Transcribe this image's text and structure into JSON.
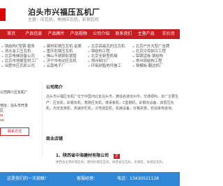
{
  "header": {
    "brand": "泊头市兴福压瓦机厂",
    "brand_sub": "主营：压瓦机，角驰压瓦机，彩钢瓦机"
  },
  "nav": [
    "首页",
    "产品信息",
    "产品图片",
    "产品视频",
    "公司介绍",
    "联系我们",
    "主营产品",
    "实价页"
  ],
  "links": [
    [
      "钢结构C型钢·檩条",
      "清水金工压瓦机",
      "北京电梯设备公司",
      "北京市地暖管材工厂",
      "合肥市压瓦机公司"
    ],
    [
      "建材彩钢压瓦机·金属",
      "重庆彩钢压瓦机",
      "佛山不锈钢彩钢管",
      "济宁市电动压瓦机",
      "云南电子厂"
    ],
    [
      "北京高级瓦的压瓦机",
      "钢结构工程",
      "北京全新型机械",
      "郑州制冷厂",
      "环氧树脂地坪施工"
    ],
    [
      "北京户外大型广告牌",
      "北京冷库制冷工程",
      "铝镁锰板·钢结构",
      "常州钢结构工程",
      "钢模板·翻边机厂"
    ]
  ],
  "left": {
    "line1": "公司简介压瓦机厂",
    "line2": "地址：泊头市开发区",
    "red1": "ie",
    "red2": "se",
    "button": "联系方式"
  },
  "about": {
    "title": "公司简介",
    "body": "泊头市兴福压瓦机厂位于中国河北省泊头市，铸造名城沧州市，交通便利。本厂主要生产：压瓦机，彩钢瓦机，角驰压瓦机，楼承板机，C型钢机，彩钢瓦设备，双层压瓦机，光伏支架机，高速护栏机，冷弯成型机，机械设备，价格实惠，欢迎来电咨询。"
  },
  "shop": {
    "title": "商业店铺",
    "name": "1、陕西省中海建材有限公司",
    "tag": "店",
    "desc": "陕西省主营彩钢瓦机，建材彩钢压瓦机，陕西省压瓦机，彩钢瓦，角驰压瓦机。"
  },
  "bar": {
    "left": "这是我们的一次接触！",
    "mid": "客服经理：",
    "right": "电话：13430521128"
  }
}
